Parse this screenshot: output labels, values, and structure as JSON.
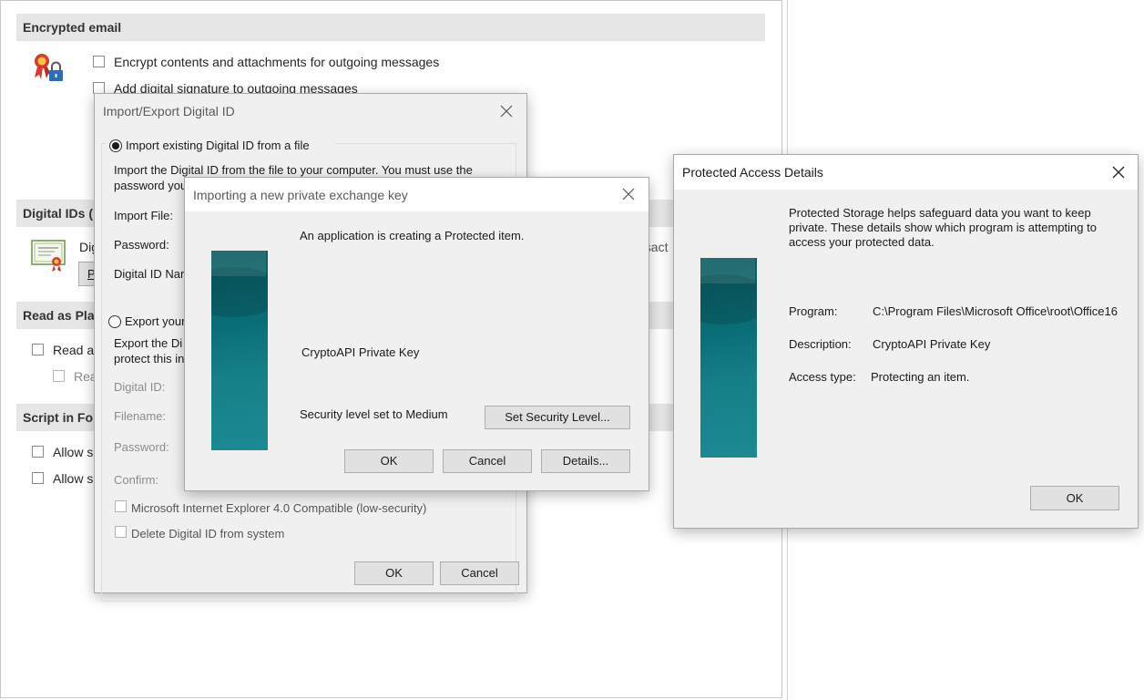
{
  "trust_center": {
    "encrypted_email_header": "Encrypted email",
    "encrypt_option": "Encrypt contents and attachments for outgoing messages",
    "signature_option": "Add digital signature to outgoing messages",
    "digital_ids_header_partial": "Digital IDs (",
    "digital_ids_text_partial": "Dig",
    "digital_ids_btn_partial": "P",
    "digital_ids_right_partial": "nsact",
    "read_plain_header_partial": "Read as Pla",
    "read_all_partial": "Read a",
    "read_signed_partial": "Rea",
    "script_header_partial": "Script in Fo",
    "allow1_partial": "Allow s",
    "allow2_partial": "Allow s"
  },
  "import_export_dialog": {
    "title": "Import/Export Digital ID",
    "import_radio": "Import existing Digital ID from a file",
    "import_desc_line1": "Import the Digital ID from the file to your computer. You must use the",
    "import_desc_line2_partial": "password you",
    "import_file_label": "Import File:",
    "password_label": "Password:",
    "digital_id_name_partial": "Digital ID Nar",
    "export_radio_partial": "Export your",
    "export_desc_line1_partial": "Export the Di",
    "export_desc_line2_partial": "protect this in",
    "digital_id_label": "Digital ID:",
    "filename_label": "Filename:",
    "export_password_label": "Password:",
    "confirm_label": "Confirm:",
    "ie4_option": "Microsoft Internet Explorer 4.0 Compatible (low-security)",
    "delete_option": "Delete Digital ID from system",
    "ok": "OK",
    "cancel": "Cancel"
  },
  "private_key_dialog": {
    "title": "Importing a new private exchange key",
    "message": "An application is creating a Protected item.",
    "item_name": "CryptoAPI Private Key",
    "security_level": "Security level set to Medium",
    "set_security_button": "Set Security Level...",
    "ok": "OK",
    "cancel": "Cancel",
    "details": "Details..."
  },
  "protected_details_dialog": {
    "title": "Protected Access Details",
    "description_line1": "Protected Storage helps safeguard data you want to keep",
    "description_line2": "private. These details show which program is attempting to",
    "description_line3": "access your protected data.",
    "program_label": "Program:",
    "program_value": "C:\\Program Files\\Microsoft Office\\root\\Office16",
    "description_label": "Description:",
    "description_value": "CryptoAPI Private Key",
    "access_type_label": "Access type:",
    "access_type_value": "Protecting an item.",
    "ok": "OK"
  },
  "icons": {
    "certificate_lock": "certificate-lock-icon",
    "certificate_doc": "certificate-document-icon",
    "close": "close-icon"
  },
  "colors": {
    "section_header_bg": "#e6e6e6",
    "dialog_bg": "#f0f0f0",
    "banner_teal": "#0a6e78"
  }
}
